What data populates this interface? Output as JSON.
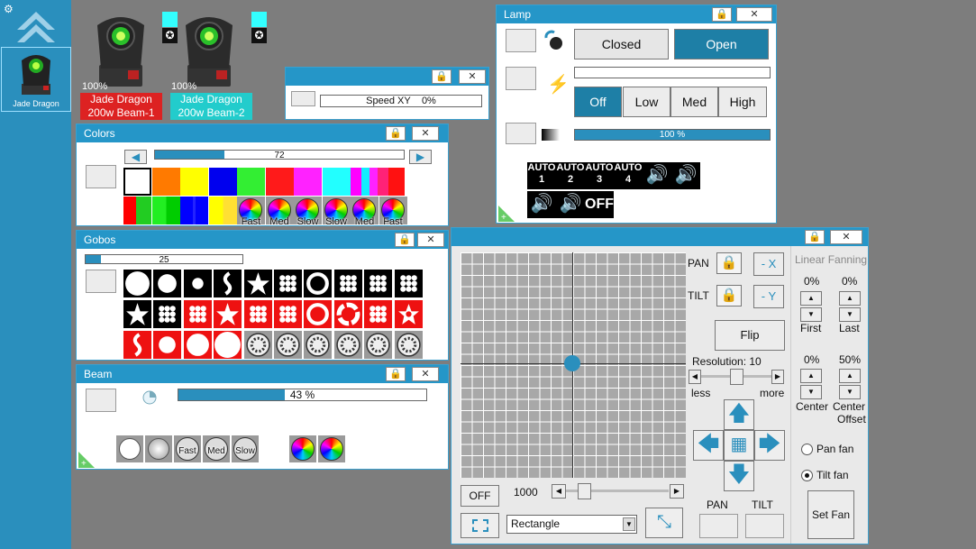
{
  "sidebar": {
    "fixture_label": "Jade Dragon"
  },
  "fixtures": [
    {
      "percent": "100%",
      "name_line1": "Jade Dragon",
      "name_line2": "200w Beam-1",
      "color": "#dd2222"
    },
    {
      "percent": "100%",
      "name_line1": "Jade Dragon",
      "name_line2": "200w Beam-2",
      "color": "#22cccc"
    }
  ],
  "speed": {
    "label": "Speed XY",
    "value": "0%"
  },
  "colors": {
    "title": "Colors",
    "slider_value": "72",
    "slider_fraction": 0.28,
    "swatches_row1": [
      "#ffffff",
      "#ff7a00",
      "#ffff00",
      "#0000ee",
      "#33ee33",
      "#ff1a1a",
      "#ff22ff",
      "#22ffff",
      "multi"
    ],
    "wheel_labels": [
      "Fast",
      "Med",
      "Slow",
      "Slow",
      "Med",
      "Fast"
    ]
  },
  "gobos": {
    "title": "Gobos",
    "slider_value": "25",
    "slider_fraction": 0.1
  },
  "beam": {
    "title": "Beam",
    "value": "43 %",
    "fraction": 0.43,
    "wheel_labels": [
      "Fast",
      "Med",
      "Slow"
    ]
  },
  "lamp": {
    "title": "Lamp",
    "closed": "Closed",
    "open": "Open",
    "levels": [
      "Off",
      "Low",
      "Med",
      "High"
    ],
    "dimmer": "100 %",
    "auto": [
      "AUTO 1",
      "AUTO 2",
      "AUTO 3",
      "AUTO 4"
    ],
    "off_label": "OFF"
  },
  "pantilt": {
    "pan": "PAN",
    "tilt": "TILT",
    "neg_x": "- X",
    "neg_y": "- Y",
    "flip": "Flip",
    "resolution": "Resolution: 10",
    "less": "less",
    "more": "more",
    "off": "OFF",
    "speed_value": "1000",
    "shape": "Rectangle",
    "pan_label": "PAN",
    "tilt_label": "TILT"
  },
  "fanning": {
    "title": "Linear Fanning",
    "first_pct": "0%",
    "last_pct": "0%",
    "first": "First",
    "last": "Last",
    "center_pct": "0%",
    "offset_pct": "50%",
    "center": "Center",
    "center_offset_1": "Center",
    "center_offset_2": "Offset",
    "pan_fan": "Pan fan",
    "tilt_fan": "Tilt fan",
    "set_fan": "Set Fan"
  }
}
